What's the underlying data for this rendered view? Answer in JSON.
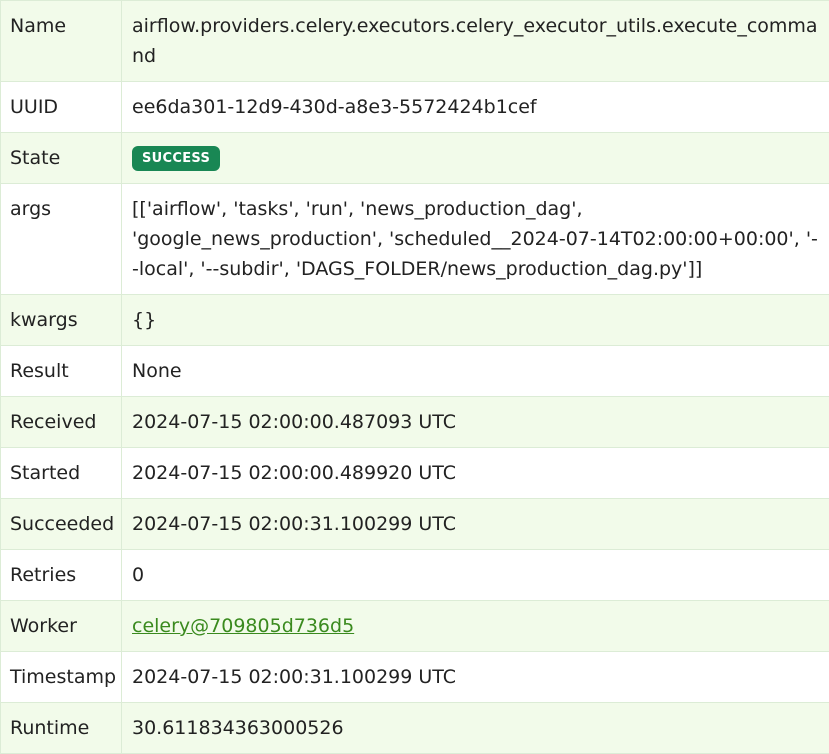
{
  "rows": {
    "name": {
      "key": "Name",
      "value": "airflow.providers.celery.executors.celery_executor_utils.execute_command"
    },
    "uuid": {
      "key": "UUID",
      "value": "ee6da301-12d9-430d-a8e3-5572424b1cef"
    },
    "state": {
      "key": "State",
      "value": "SUCCESS"
    },
    "args": {
      "key": "args",
      "value": "[['airflow', 'tasks', 'run', 'news_production_dag', 'google_news_production', 'scheduled__2024-07-14T02:00:00+00:00', '--local', '--subdir', 'DAGS_FOLDER/news_production_dag.py']]"
    },
    "kwargs": {
      "key": "kwargs",
      "value": "{}"
    },
    "result": {
      "key": "Result",
      "value": "None"
    },
    "received": {
      "key": "Received",
      "value": "2024-07-15 02:00:00.487093 UTC"
    },
    "started": {
      "key": "Started",
      "value": "2024-07-15 02:00:00.489920 UTC"
    },
    "succeeded": {
      "key": "Succeeded",
      "value": "2024-07-15 02:00:31.100299 UTC"
    },
    "retries": {
      "key": "Retries",
      "value": "0"
    },
    "worker": {
      "key": "Worker",
      "value": "celery@709805d736d5"
    },
    "timestamp": {
      "key": "Timestamp",
      "value": "2024-07-15 02:00:31.100299 UTC"
    },
    "runtime": {
      "key": "Runtime",
      "value": "30.611834363000526"
    }
  },
  "colors": {
    "row_stripe": "#f2fbea",
    "success_badge": "#198754",
    "link": "#3a8a1e"
  }
}
